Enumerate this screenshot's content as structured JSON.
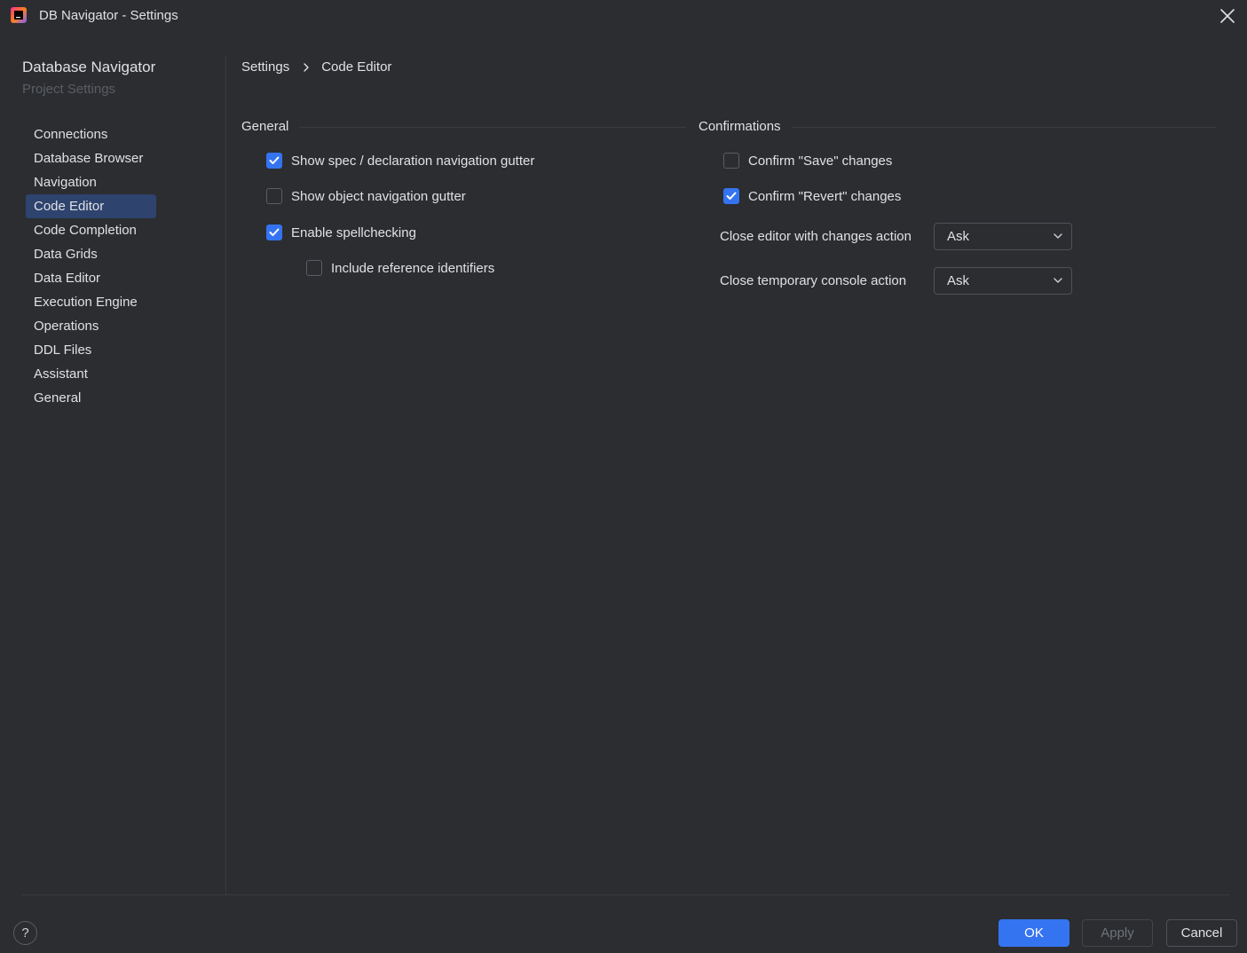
{
  "window": {
    "title": "DB Navigator - Settings"
  },
  "sidebar": {
    "app_name": "Database Navigator",
    "app_subtitle": "Project Settings",
    "items": [
      {
        "label": "Connections"
      },
      {
        "label": "Database Browser"
      },
      {
        "label": "Navigation"
      },
      {
        "label": "Code Editor"
      },
      {
        "label": "Code Completion"
      },
      {
        "label": "Data Grids"
      },
      {
        "label": "Data Editor"
      },
      {
        "label": "Execution Engine"
      },
      {
        "label": "Operations"
      },
      {
        "label": "DDL Files"
      },
      {
        "label": "Assistant"
      },
      {
        "label": "General"
      }
    ],
    "selected": "Code Editor"
  },
  "breadcrumb": {
    "root": "Settings",
    "current": "Code Editor"
  },
  "general": {
    "title": "General",
    "show_spec_gutter": {
      "label": "Show spec / declaration navigation gutter",
      "checked": true
    },
    "show_object_gutter": {
      "label": "Show object navigation gutter",
      "checked": false
    },
    "enable_spellcheck": {
      "label": "Enable spellchecking",
      "checked": true
    },
    "include_ref_ids": {
      "label": "Include reference identifiers",
      "checked": false
    }
  },
  "confirmations": {
    "title": "Confirmations",
    "confirm_save": {
      "label": "Confirm \"Save\" changes",
      "checked": false
    },
    "confirm_revert": {
      "label": "Confirm \"Revert\" changes",
      "checked": true
    },
    "close_editor_action": {
      "label": "Close editor with changes action",
      "value": "Ask"
    },
    "close_console_action": {
      "label": "Close temporary console action",
      "value": "Ask"
    }
  },
  "footer": {
    "help": "?",
    "ok": "OK",
    "apply": "Apply",
    "cancel": "Cancel"
  },
  "colors": {
    "accent": "#3574f0",
    "selection": "#2e436e",
    "background": "#2b2d30"
  }
}
